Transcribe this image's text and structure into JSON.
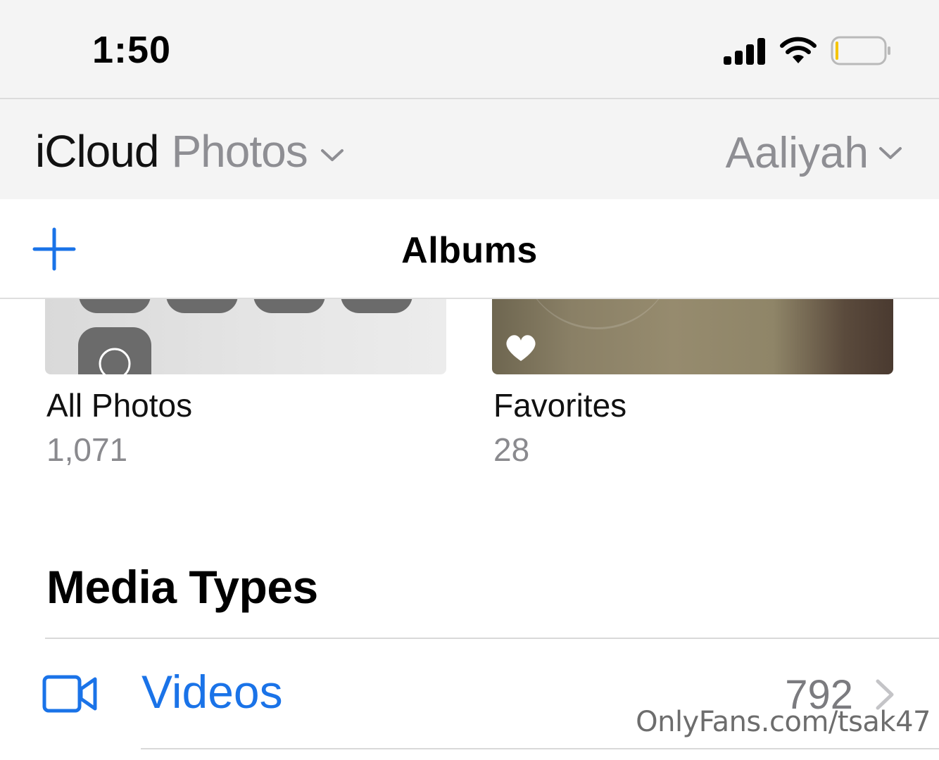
{
  "status_bar": {
    "time": "1:50",
    "icons": [
      "signal-icon",
      "wifi-icon",
      "battery-icon"
    ],
    "battery_level": 0.05,
    "battery_color": "#f5c400"
  },
  "header": {
    "brand_primary": "iCloud",
    "brand_secondary": "Photos",
    "account_name": "Aaliyah"
  },
  "albums_bar": {
    "title": "Albums",
    "add_icon": "plus-icon",
    "accent": "#1a73e8"
  },
  "albums": [
    {
      "name": "All Photos",
      "count": "1,071"
    },
    {
      "name": "Favorites",
      "count": "28",
      "badge_icon": "heart-icon"
    }
  ],
  "media_types": {
    "title": "Media Types",
    "rows": [
      {
        "label": "Videos",
        "count": "792",
        "icon": "video-camera-icon"
      }
    ]
  },
  "watermark": "OnlyFans.com/tsak47"
}
